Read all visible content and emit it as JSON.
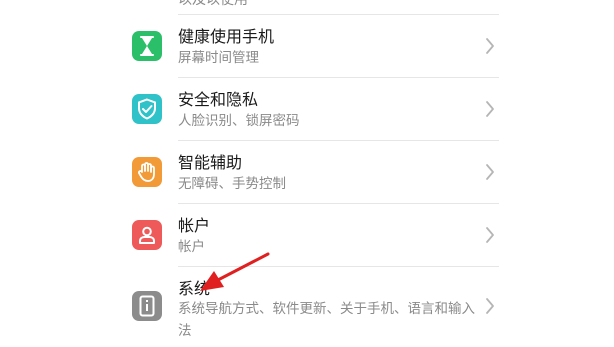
{
  "top_partial_text": "以及以使用",
  "items": [
    {
      "id": "health",
      "title": "健康使用手机",
      "subtitle": "屏幕时间管理",
      "icon": "hourglass-icon",
      "color": "#2bbf6a"
    },
    {
      "id": "security",
      "title": "安全和隐私",
      "subtitle": "人脸识别、锁屏密码",
      "icon": "shield-check-icon",
      "color": "#2fc2c8"
    },
    {
      "id": "accessibility",
      "title": "智能辅助",
      "subtitle": "无障碍、手势控制",
      "icon": "hand-icon",
      "color": "#f29a38"
    },
    {
      "id": "account",
      "title": "帐户",
      "subtitle": "帐户",
      "icon": "person-icon",
      "color": "#ee5a5a"
    },
    {
      "id": "system",
      "title": "系统",
      "subtitle": "系统导航方式、软件更新、关于手机、语言和输入法",
      "icon": "system-info-icon",
      "color": "#8c8c8c"
    }
  ],
  "annotation_color": "#e02020"
}
